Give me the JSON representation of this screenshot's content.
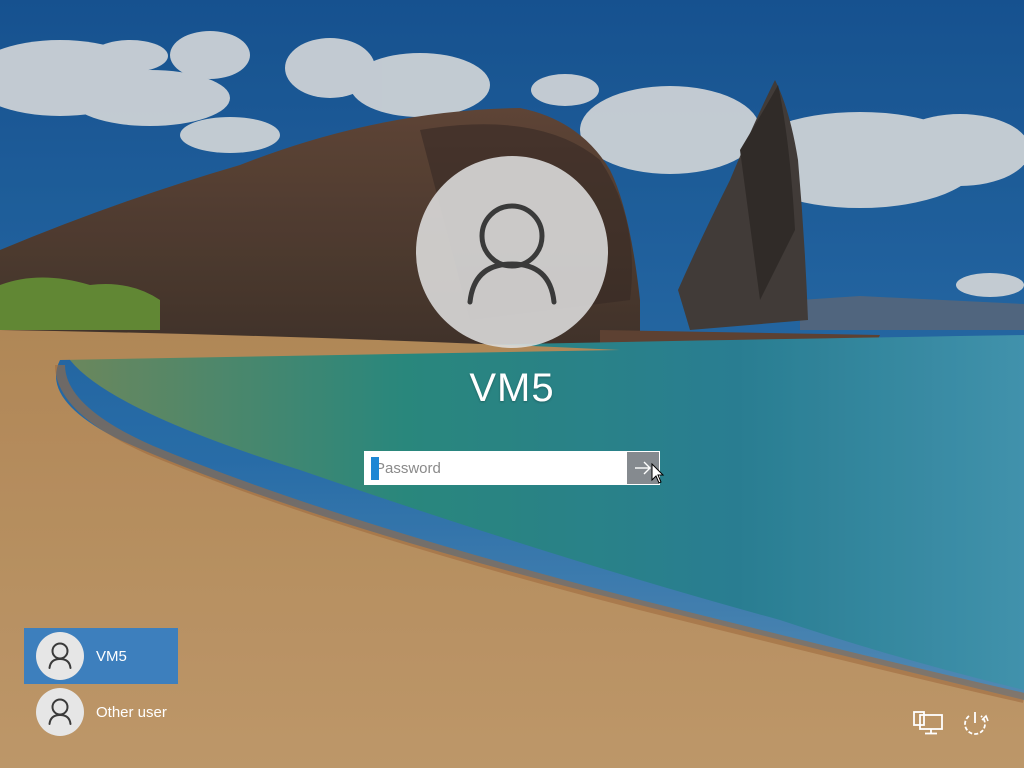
{
  "lock_screen": {
    "username": "VM5",
    "password_placeholder": "Password"
  },
  "user_list": [
    {
      "label": "VM5",
      "selected": true
    },
    {
      "label": "Other user",
      "selected": false
    }
  ],
  "icons": {
    "submit": "arrow-right-icon",
    "avatar": "user-silhouette-icon",
    "network": "network-icon",
    "power": "power-icon"
  },
  "colors": {
    "selected_tile": "#3d7fbd",
    "caret": "#1e87d4",
    "submit_button": "#858a8f"
  }
}
